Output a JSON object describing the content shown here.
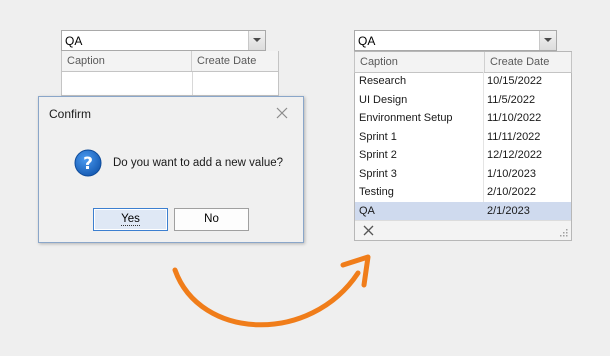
{
  "left": {
    "combo_value": "QA",
    "columns": [
      "Caption",
      "Create Date"
    ]
  },
  "dialog": {
    "title": "Confirm",
    "message": "Do you want to add a new value?",
    "yes_label": "Yes",
    "no_label": "No",
    "icon": "question-icon"
  },
  "right": {
    "combo_value": "QA",
    "columns": [
      "Caption",
      "Create Date"
    ],
    "rows": [
      {
        "caption": "Research",
        "date": "10/15/2022"
      },
      {
        "caption": "UI Design",
        "date": "11/5/2022"
      },
      {
        "caption": "Environment Setup",
        "date": "11/10/2022"
      },
      {
        "caption": "Sprint 1",
        "date": "11/11/2022"
      },
      {
        "caption": "Sprint 2",
        "date": "12/12/2022"
      },
      {
        "caption": "Sprint 3",
        "date": "1/10/2023"
      },
      {
        "caption": "Testing",
        "date": "2/10/2022"
      },
      {
        "caption": "QA",
        "date": "2/1/2023"
      }
    ],
    "selected_index": 7
  },
  "colors": {
    "accent": "#1e6fc8",
    "selection": "#cfdaee",
    "arrow": "#f07d1a"
  }
}
